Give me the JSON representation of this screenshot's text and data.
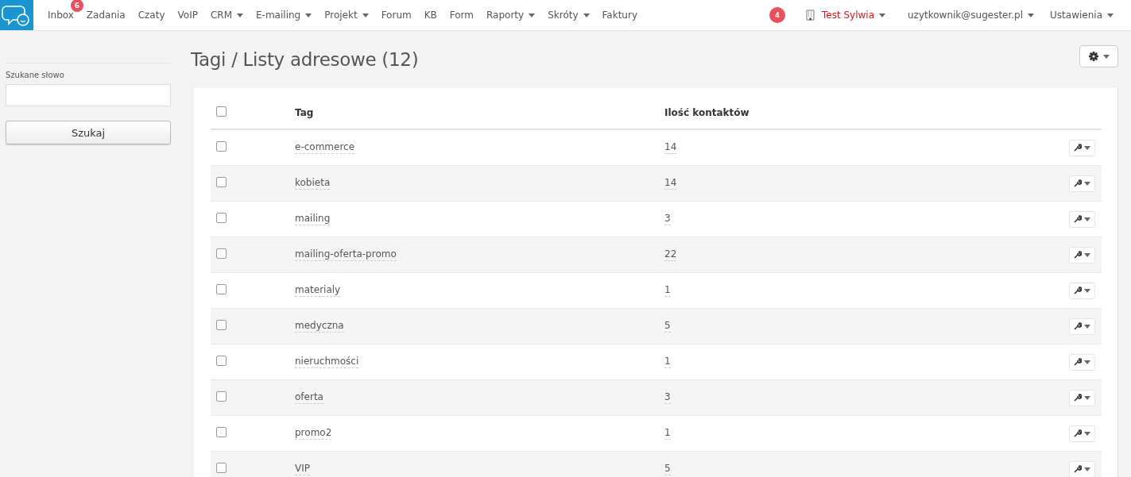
{
  "nav": {
    "items": [
      {
        "label": "Inbox",
        "dropdown": false,
        "badge": "6"
      },
      {
        "label": "Zadania",
        "dropdown": false
      },
      {
        "label": "Czaty",
        "dropdown": false
      },
      {
        "label": "VoIP",
        "dropdown": false
      },
      {
        "label": "CRM",
        "dropdown": true
      },
      {
        "label": "E-mailing",
        "dropdown": true
      },
      {
        "label": "Projekt",
        "dropdown": true
      },
      {
        "label": "Forum",
        "dropdown": false
      },
      {
        "label": "KB",
        "dropdown": false
      },
      {
        "label": "Form",
        "dropdown": false
      },
      {
        "label": "Raporty",
        "dropdown": true
      },
      {
        "label": "Skróty",
        "dropdown": true
      },
      {
        "label": "Faktury",
        "dropdown": false
      }
    ],
    "notifications": "4",
    "account": "Test Sylwia",
    "user": "uzytkownik@sugester.pl",
    "settings": "Ustawienia"
  },
  "sidebar": {
    "search_label": "Szukane słowo",
    "search_button": "Szukaj"
  },
  "page": {
    "title": "Tagi / Listy adresowe (12)"
  },
  "table": {
    "columns": [
      "Tag",
      "Ilość kontaktów"
    ],
    "select_all_checked": false,
    "rows": [
      {
        "tag": "e-commerce",
        "count": "14",
        "checked": false
      },
      {
        "tag": "kobieta",
        "count": "14",
        "checked": false
      },
      {
        "tag": "mailing",
        "count": "3",
        "checked": false
      },
      {
        "tag": "mailing-oferta-promo",
        "count": "22",
        "checked": false
      },
      {
        "tag": "materialy",
        "count": "1",
        "checked": false
      },
      {
        "tag": "medyczna",
        "count": "5",
        "checked": false
      },
      {
        "tag": "nieruchmości",
        "count": "1",
        "checked": false
      },
      {
        "tag": "oferta",
        "count": "3",
        "checked": false
      },
      {
        "tag": "promo2",
        "count": "1",
        "checked": false
      },
      {
        "tag": "VIP",
        "count": "5",
        "checked": false
      }
    ]
  }
}
